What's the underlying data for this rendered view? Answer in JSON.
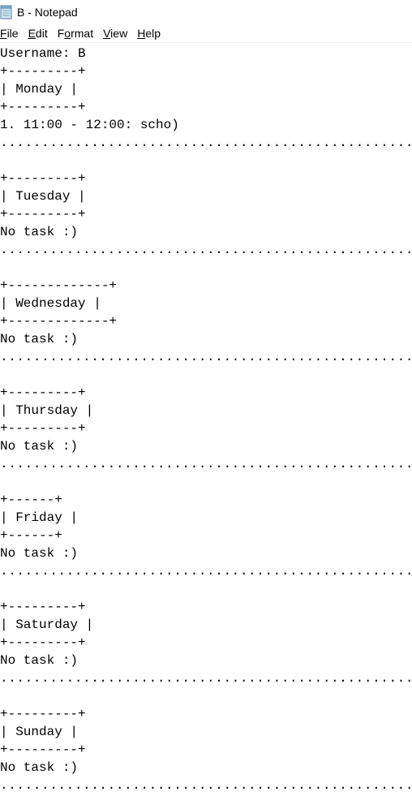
{
  "window": {
    "title": "B - Notepad",
    "icon": "notepad-icon"
  },
  "menu": [
    {
      "key": "F",
      "rest": "ile"
    },
    {
      "key": "E",
      "rest": "dit"
    },
    {
      "key": "o",
      "pre": "F",
      "rest": "rmat"
    },
    {
      "key": "V",
      "rest": "iew"
    },
    {
      "key": "H",
      "rest": "elp"
    }
  ],
  "document": {
    "lines": [
      "Username: B",
      "+---------+",
      "| Monday |",
      "+---------+",
      "1. 11:00 - 12:00: scho)",
      "..........................................................",
      "",
      "+---------+",
      "| Tuesday |",
      "+---------+",
      "No task :)",
      "..........................................................",
      "",
      "+-------------+",
      "| Wednesday |",
      "+-------------+",
      "No task :)",
      "..........................................................",
      "",
      "+---------+",
      "| Thursday |",
      "+---------+",
      "No task :)",
      "..........................................................",
      "",
      "+------+",
      "| Friday |",
      "+------+",
      "No task :)",
      "..........................................................",
      "",
      "+---------+",
      "| Saturday |",
      "+---------+",
      "No task :)",
      "..........................................................",
      "",
      "+---------+",
      "| Sunday |",
      "+---------+",
      "No task :)",
      ".........................................................."
    ]
  }
}
